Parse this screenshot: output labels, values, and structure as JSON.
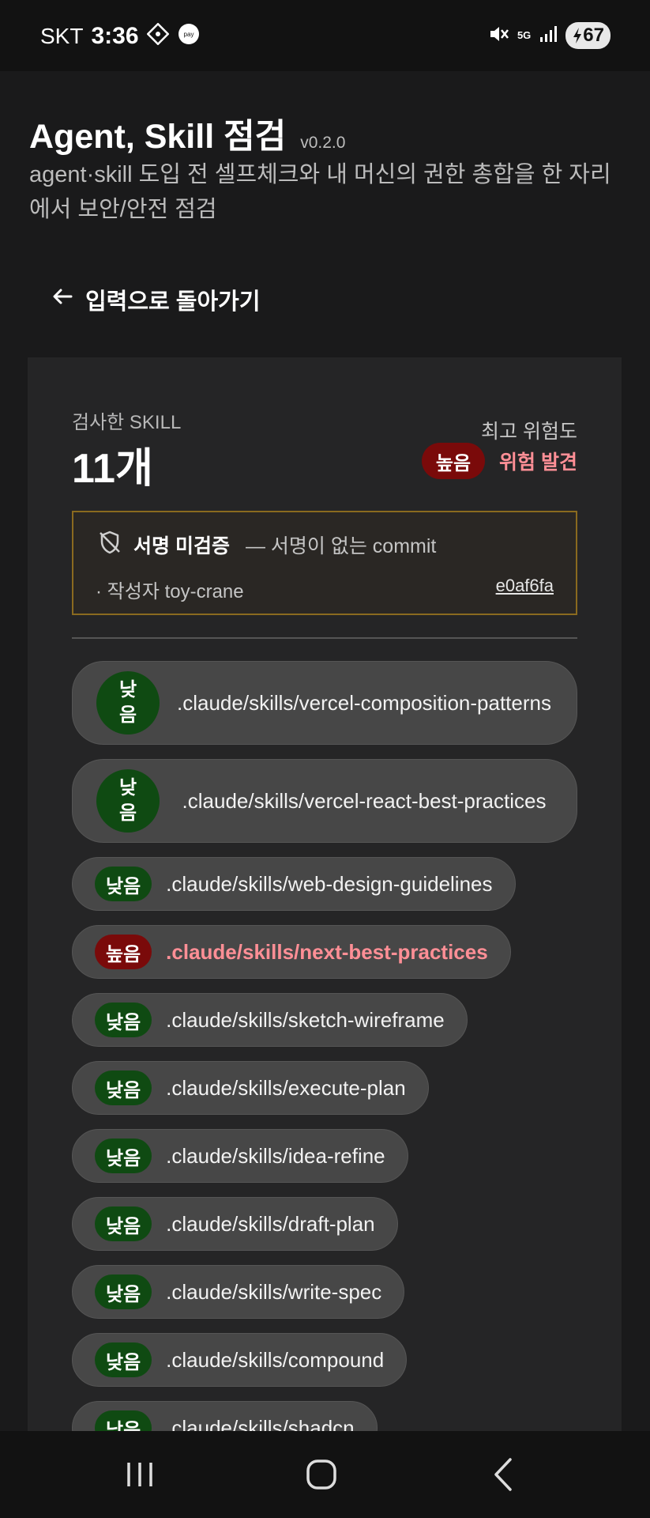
{
  "status_bar": {
    "carrier": "SKT",
    "time": "3:36",
    "network": "5G",
    "battery": "67"
  },
  "header": {
    "title": "Agent, Skill 점검",
    "version": "v0.2.0",
    "subtitle": "agent·skill 도입 전 셀프체크와 내 머신의 권한 총합을 한 자리에서 보안/안전 점검"
  },
  "back_link": "입력으로 돌아가기",
  "summary": {
    "count_label": "검사한 SKILL",
    "count": "11개",
    "risk_label": "최고 위험도",
    "risk_level": "높음",
    "risk_text": "위험 발견"
  },
  "signature": {
    "title": "서명 미검증",
    "desc": "— 서명이 없는 commit",
    "author": "· 작성자 toy-crane",
    "commit": "e0af6fa"
  },
  "skills": [
    {
      "level": "낮음",
      "path": ".claude/skills/vercel-composition-patterns"
    },
    {
      "level": "낮음",
      "path": ".claude/skills/vercel-react-best-practices"
    },
    {
      "level": "낮음",
      "path": ".claude/skills/web-design-guidelines"
    },
    {
      "level": "높음",
      "path": ".claude/skills/next-best-practices"
    },
    {
      "level": "낮음",
      "path": ".claude/skills/sketch-wireframe"
    },
    {
      "level": "낮음",
      "path": ".claude/skills/execute-plan"
    },
    {
      "level": "낮음",
      "path": ".claude/skills/idea-refine"
    },
    {
      "level": "낮음",
      "path": ".claude/skills/draft-plan"
    },
    {
      "level": "낮음",
      "path": ".claude/skills/write-spec"
    },
    {
      "level": "낮음",
      "path": ".claude/skills/compound"
    },
    {
      "level": "낮음",
      "path": ".claude/skills/shadcn"
    }
  ],
  "colors": {
    "low": "#0f4a12",
    "high": "#7a0a0a",
    "high_text": "#ff8f96",
    "warning_border": "#8a6a1f"
  }
}
